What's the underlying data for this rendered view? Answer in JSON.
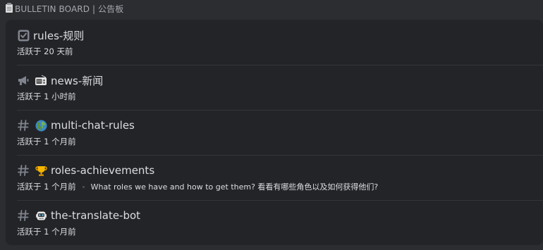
{
  "category": {
    "label": "BULLETIN BOARD | 公告板",
    "icon": "clipboard-icon"
  },
  "channels": [
    {
      "type_icon": "checkbox-icon",
      "emoji_icon": "",
      "name": "rules-规则",
      "activity": "活跃于 20 天前",
      "preview": ""
    },
    {
      "type_icon": "megaphone-icon",
      "emoji_icon": "radio-icon",
      "name": "news-新闻",
      "activity": "活跃于 1 小时前",
      "preview": ""
    },
    {
      "type_icon": "hash-icon",
      "emoji_icon": "globe-icon",
      "name": "multi-chat-rules",
      "activity": "活跃于 1 个月前",
      "preview": ""
    },
    {
      "type_icon": "hash-icon",
      "emoji_icon": "trophy-icon",
      "name": "roles-achievements",
      "activity": "活跃于 1 个月前",
      "preview": "What roles we have and how to get them? 看看有哪些角色以及如何获得他们?"
    },
    {
      "type_icon": "hash-icon",
      "emoji_icon": "robot-icon",
      "name": "the-translate-bot",
      "activity": "活跃于 1 个月前",
      "preview": ""
    }
  ],
  "colors": {
    "background": "#2b2d31",
    "panel": "#232428",
    "divider": "#34363b",
    "text": "#dbdee1",
    "muted_icon": "#80848e",
    "header_text": "#a5a8ad"
  }
}
